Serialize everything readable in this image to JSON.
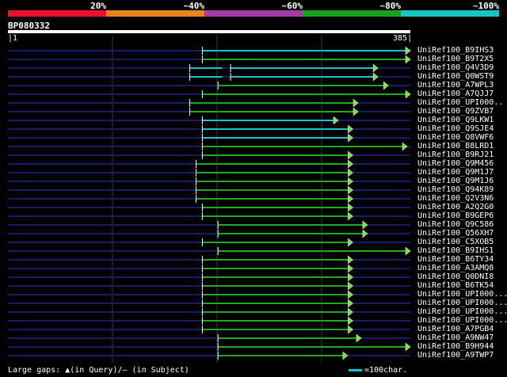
{
  "legend": {
    "segments": [
      {
        "label": "20%",
        "color": "#e8132b"
      },
      {
        "label": "~40%",
        "color": "#e88420"
      },
      {
        "label": "~60%",
        "color": "#a53ca5"
      },
      {
        "label": "~80%",
        "color": "#19a219"
      },
      {
        "label": "~100%",
        "color": "#19c4c4"
      }
    ]
  },
  "query": {
    "id": "BP080332",
    "start": "1",
    "end": "385"
  },
  "hits": [
    {
      "name": "UniRef100_B9IHS3",
      "start": 186,
      "end": 385,
      "color": "cyan",
      "segments": [
        [
          186,
          385
        ]
      ]
    },
    {
      "name": "UniRef100_B9T2X5",
      "start": 186,
      "end": 385,
      "color": "green",
      "segments": [
        [
          186,
          385
        ]
      ]
    },
    {
      "name": "UniRef100_Q4V3D9",
      "start": 174,
      "end": 354,
      "color": "cyan",
      "segments": [
        [
          174,
          205
        ],
        [
          213,
          354
        ]
      ]
    },
    {
      "name": "UniRef100_Q0WST9",
      "start": 174,
      "end": 354,
      "color": "cyan",
      "segments": [
        [
          174,
          205
        ],
        [
          213,
          354
        ]
      ]
    },
    {
      "name": "UniRef100_A7WPL3",
      "start": 201,
      "end": 364,
      "color": "green",
      "segments": [
        [
          201,
          364
        ]
      ]
    },
    {
      "name": "UniRef100_A7QJJ7",
      "start": 186,
      "end": 385,
      "color": "green",
      "segments": [
        [
          186,
          385
        ]
      ]
    },
    {
      "name": "UniRef100_UPI000..",
      "start": 174,
      "end": 335,
      "color": "green",
      "segments": [
        [
          174,
          335
        ]
      ]
    },
    {
      "name": "UniRef100_Q9ZVB7",
      "start": 174,
      "end": 335,
      "color": "green",
      "segments": [
        [
          174,
          335
        ]
      ]
    },
    {
      "name": "UniRef100_Q9LKW1",
      "start": 186,
      "end": 316,
      "color": "cyan",
      "segments": [
        [
          186,
          316
        ]
      ]
    },
    {
      "name": "UniRef100_Q9SJE4",
      "start": 186,
      "end": 330,
      "color": "cyan",
      "segments": [
        [
          186,
          330
        ]
      ]
    },
    {
      "name": "UniRef100_Q8VWF6",
      "start": 186,
      "end": 330,
      "color": "cyan",
      "segments": [
        [
          186,
          330
        ]
      ]
    },
    {
      "name": "UniRef100_B8LRD1",
      "start": 186,
      "end": 382,
      "color": "green",
      "segments": [
        [
          186,
          382
        ]
      ]
    },
    {
      "name": "UniRef100_B9RJ21",
      "start": 186,
      "end": 330,
      "color": "green",
      "segments": [
        [
          186,
          330
        ]
      ]
    },
    {
      "name": "UniRef100_Q9M456",
      "start": 180,
      "end": 330,
      "color": "green",
      "segments": [
        [
          180,
          330
        ]
      ]
    },
    {
      "name": "UniRef100_Q9M1J7",
      "start": 180,
      "end": 330,
      "color": "green",
      "segments": [
        [
          180,
          330
        ]
      ]
    },
    {
      "name": "UniRef100_Q9M1J6",
      "start": 180,
      "end": 330,
      "color": "green",
      "segments": [
        [
          180,
          330
        ]
      ]
    },
    {
      "name": "UniRef100_Q94K89",
      "start": 180,
      "end": 330,
      "color": "green",
      "segments": [
        [
          180,
          330
        ]
      ]
    },
    {
      "name": "UniRef100_Q2V3N6",
      "start": 180,
      "end": 330,
      "color": "green",
      "segments": [
        [
          180,
          330
        ]
      ]
    },
    {
      "name": "UniRef100_A2Q2G0",
      "start": 186,
      "end": 330,
      "color": "green",
      "segments": [
        [
          186,
          330
        ]
      ]
    },
    {
      "name": "UniRef100_B9GEP6",
      "start": 186,
      "end": 330,
      "color": "green",
      "segments": [
        [
          186,
          330
        ]
      ]
    },
    {
      "name": "UniRef100_Q9C586",
      "start": 201,
      "end": 344,
      "color": "green",
      "segments": [
        [
          201,
          344
        ]
      ]
    },
    {
      "name": "UniRef100_Q56XH7",
      "start": 201,
      "end": 344,
      "color": "green",
      "segments": [
        [
          201,
          344
        ]
      ]
    },
    {
      "name": "UniRef100_C5XOB5",
      "start": 186,
      "end": 330,
      "color": "green",
      "segments": [
        [
          186,
          330
        ]
      ]
    },
    {
      "name": "UniRef100_B9IHS1",
      "start": 201,
      "end": 385,
      "color": "green",
      "segments": [
        [
          201,
          385
        ]
      ]
    },
    {
      "name": "UniRef100_B6TY34",
      "start": 186,
      "end": 330,
      "color": "green",
      "segments": [
        [
          186,
          330
        ]
      ]
    },
    {
      "name": "UniRef100_A3AMQ8",
      "start": 186,
      "end": 330,
      "color": "green",
      "segments": [
        [
          186,
          330
        ]
      ]
    },
    {
      "name": "UniRef100_Q0DNI8",
      "start": 186,
      "end": 330,
      "color": "green",
      "segments": [
        [
          186,
          330
        ]
      ]
    },
    {
      "name": "UniRef100_B6TK54",
      "start": 186,
      "end": 330,
      "color": "green",
      "segments": [
        [
          186,
          330
        ]
      ]
    },
    {
      "name": "UniRef100_UPI000...",
      "start": 186,
      "end": 330,
      "color": "green",
      "segments": [
        [
          186,
          330
        ]
      ]
    },
    {
      "name": "UniRef100_UPI000...",
      "start": 186,
      "end": 330,
      "color": "green",
      "segments": [
        [
          186,
          330
        ]
      ]
    },
    {
      "name": "UniRef100_UPI000...",
      "start": 186,
      "end": 330,
      "color": "green",
      "segments": [
        [
          186,
          330
        ]
      ]
    },
    {
      "name": "UniRef100_UPI000...",
      "start": 186,
      "end": 330,
      "color": "green",
      "segments": [
        [
          186,
          330
        ]
      ]
    },
    {
      "name": "UniRef100_A7PGB4",
      "start": 186,
      "end": 330,
      "color": "green",
      "segments": [
        [
          186,
          330
        ]
      ]
    },
    {
      "name": "UniRef100_A9NW47",
      "start": 201,
      "end": 338,
      "color": "green",
      "segments": [
        [
          201,
          338
        ]
      ]
    },
    {
      "name": "UniRef100_B9H944",
      "start": 201,
      "end": 385,
      "color": "green",
      "segments": [
        [
          201,
          385
        ]
      ]
    },
    {
      "name": "UniRef100_A9TWP7",
      "start": 201,
      "end": 325,
      "color": "green",
      "segments": [
        [
          201,
          325
        ]
      ]
    }
  ],
  "colors": {
    "cyan": "#19c4d4",
    "green": "#1faa1f",
    "arrow_fill": "#7ddc4a",
    "baseline": "#1a1a6a",
    "grid": "#3a3a3a"
  },
  "footer": {
    "gaps_text": "Large gaps: ▲(in Query)/– (in Subject)",
    "scale_text": "=100char."
  }
}
